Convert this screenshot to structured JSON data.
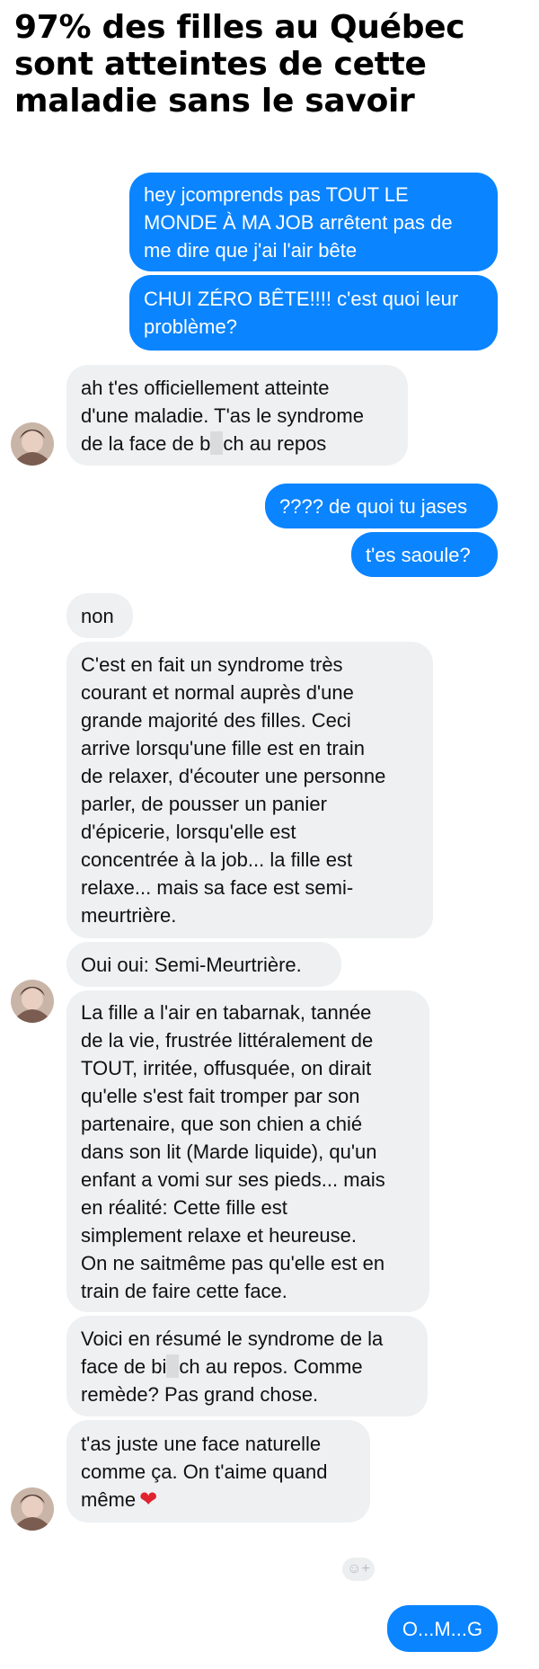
{
  "headline": {
    "lines": [
      "97% des filles au Québec",
      "sont atteintes de cette",
      "maladie sans le savoir"
    ]
  },
  "messages": {
    "m1": [
      "hey jcomprends pas TOUT LE",
      "MONDE À MA JOB arrêtent pas de",
      "me dire que j'ai l'air bête"
    ],
    "m2": [
      "CHUI ZÉRO BÊTE!!!! c'est quoi leur",
      "problème?"
    ],
    "m3a": "ah t'es officiellement atteinte",
    "m3b": "d'une maladie. T'as le syndrome",
    "m3c_pre": "de la face de b",
    "m3c_post": "ch au repos",
    "m4": "???? de quoi tu jases",
    "m5": "t'es saoule?",
    "m6": "non",
    "m7": [
      "C'est en fait un syndrome très",
      "courant et normal auprès d'une",
      "grande majorité des filles. Ceci",
      "arrive lorsqu'une fille est en train",
      "de relaxer, d'écouter une personne",
      "parler, de pousser un panier",
      "d'épicerie, lorsqu'elle est",
      "concentrée à la job... la fille est",
      "relaxe... mais sa face est semi-",
      "meurtrière."
    ],
    "m8": "Oui oui: Semi-Meurtrière.",
    "m9": [
      "La fille a l'air en tabarnak, tannée",
      "de la vie, frustrée littéralement de",
      "TOUT, irritée, offusquée, on dirait",
      "qu'elle s'est fait tromper par son",
      "partenaire, que son chien a chié",
      "dans son lit (Marde liquide), qu'un",
      "enfant a vomi sur ses pieds... mais",
      "en réalité: Cette fille est",
      "simplement relaxe et heureuse.",
      "On ne saitmême pas qu'elle est en",
      "train de faire cette face."
    ],
    "m10a": "Voici en résumé le syndrome de la",
    "m10b_pre": "face de bi",
    "m10b_post": "ch au repos. Comme",
    "m10c": "remède? Pas grand chose.",
    "m11": [
      "t'as juste une face naturelle",
      "comme ça. On t'aime quand",
      "même"
    ],
    "m12": "O...M...G"
  },
  "icons": {
    "heart": "heart-icon",
    "reaction": "add-reaction-icon",
    "avatar": "contact-avatar"
  },
  "colors": {
    "outgoing": "#0a84ff",
    "incoming": "#eef0f2",
    "heart": "#e0242f"
  }
}
